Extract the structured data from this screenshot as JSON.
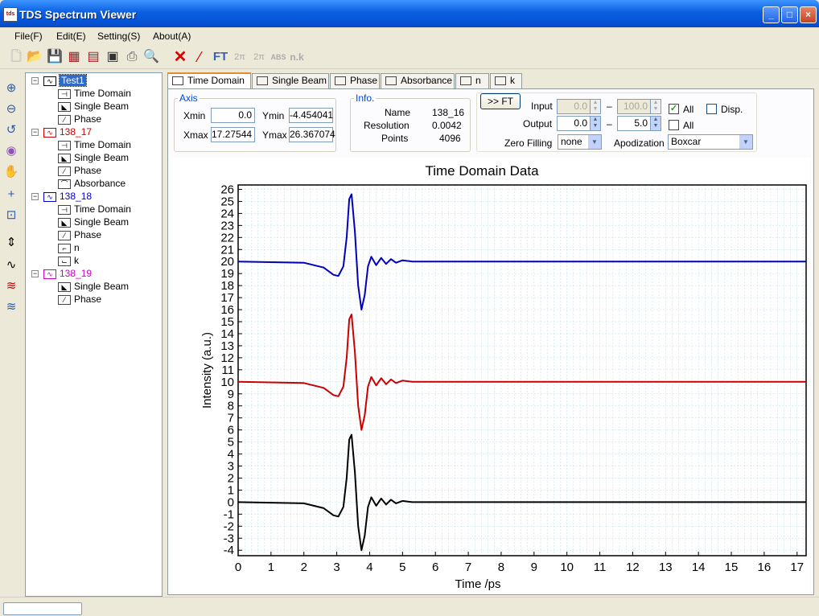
{
  "window": {
    "title": "TDS Spectrum Viewer",
    "icon_text": "tds"
  },
  "menu": [
    "File(F)",
    "Edit(E)",
    "Setting(S)",
    "About(A)"
  ],
  "toolbar": {
    "ft_label": "FT",
    "twopi_1": "2π",
    "twopi_2": "2π",
    "abs_label": "ABS",
    "nk_label": "n.k"
  },
  "tree": [
    {
      "name": "Test1",
      "color": "#000000",
      "children": [
        "Time Domain",
        "Single Beam",
        "Phase"
      ]
    },
    {
      "name": "138_17",
      "color": "#cc0000",
      "children": [
        "Time Domain",
        "Single Beam",
        "Phase",
        "Absorbance"
      ]
    },
    {
      "name": "138_18",
      "color": "#0000cc",
      "children": [
        "Time Domain",
        "Single Beam",
        "Phase",
        "n",
        "k"
      ]
    },
    {
      "name": "138_19",
      "color": "#cc00cc",
      "children": [
        "Single Beam",
        "Phase"
      ]
    }
  ],
  "tabs": [
    "Time Domain",
    "Single Beam",
    "Phase",
    "Absorbance",
    "n",
    "k"
  ],
  "axis": {
    "legend": "Axis",
    "xmin_label": "Xmin",
    "xmin": "0.0",
    "ymin_label": "Ymin",
    "ymin": "-4.454041",
    "xmax_label": "Xmax",
    "xmax": "17.27544",
    "ymax_label": "Ymax",
    "ymax": "26.367074"
  },
  "info": {
    "legend": "Info.",
    "name_label": "Name",
    "name": "138_16",
    "resolution_label": "Resolution",
    "resolution": "0.0042",
    "points_label": "Points",
    "points": "4096"
  },
  "ft": {
    "button": ">> FT",
    "input_label": "Input",
    "input_from": "0.0",
    "input_to": "100.0",
    "dash": "–",
    "output_label": "Output",
    "output_from": "0.0",
    "output_to": "5.0",
    "all_label": "All",
    "disp_label": "Disp.",
    "zero_filling_label": "Zero Filling",
    "zero_filling": "none",
    "apodization_label": "Apodization",
    "apodization": "Boxcar"
  },
  "chart_data": {
    "type": "line",
    "title": "Time Domain Data",
    "xlabel": "Time /ps",
    "ylabel": "Intensity (a.u.)",
    "xlim": [
      0,
      17.275
    ],
    "ylim": [
      -4.454,
      26.367
    ],
    "xticks": [
      0,
      1,
      2,
      3,
      4,
      5,
      6,
      7,
      8,
      9,
      10,
      11,
      12,
      13,
      14,
      15,
      16,
      17
    ],
    "yticks": [
      -4,
      -3,
      -2,
      -1,
      0,
      1,
      2,
      3,
      4,
      5,
      6,
      7,
      8,
      9,
      10,
      11,
      12,
      13,
      14,
      15,
      16,
      17,
      18,
      19,
      20,
      21,
      22,
      23,
      24,
      25,
      26
    ],
    "grid": true,
    "series": [
      {
        "color": "#0000bb",
        "x": [
          0,
          2.0,
          2.6,
          2.9,
          3.05,
          3.2,
          3.3,
          3.38,
          3.45,
          3.55,
          3.65,
          3.75,
          3.85,
          3.95,
          4.05,
          4.2,
          4.35,
          4.5,
          4.65,
          4.8,
          5.0,
          5.3,
          5.8,
          17.27
        ],
        "y": [
          20,
          19.9,
          19.5,
          18.9,
          18.8,
          19.6,
          22.0,
          25.2,
          25.6,
          22.5,
          18.0,
          16.0,
          17.2,
          19.6,
          20.4,
          19.7,
          20.3,
          19.8,
          20.2,
          19.9,
          20.1,
          20.0,
          20.0,
          20.0
        ]
      },
      {
        "color": "#cc0000",
        "x": [
          0,
          2.0,
          2.6,
          2.9,
          3.05,
          3.2,
          3.3,
          3.38,
          3.45,
          3.55,
          3.65,
          3.75,
          3.85,
          3.95,
          4.05,
          4.2,
          4.35,
          4.5,
          4.65,
          4.8,
          5.0,
          5.3,
          5.8,
          17.27
        ],
        "y": [
          10,
          9.9,
          9.5,
          8.9,
          8.8,
          9.6,
          12.0,
          15.2,
          15.6,
          12.5,
          8.0,
          6.0,
          7.2,
          9.6,
          10.4,
          9.7,
          10.3,
          9.8,
          10.2,
          9.9,
          10.1,
          10.0,
          10.0,
          10.0
        ]
      },
      {
        "color": "#000000",
        "x": [
          0,
          2.0,
          2.6,
          2.9,
          3.05,
          3.2,
          3.3,
          3.38,
          3.45,
          3.55,
          3.65,
          3.75,
          3.85,
          3.95,
          4.05,
          4.2,
          4.35,
          4.5,
          4.65,
          4.8,
          5.0,
          5.3,
          5.8,
          17.27
        ],
        "y": [
          0,
          -0.1,
          -0.5,
          -1.1,
          -1.2,
          -0.4,
          2.0,
          5.2,
          5.6,
          2.5,
          -2.0,
          -4.0,
          -2.8,
          -0.4,
          0.4,
          -0.3,
          0.3,
          -0.2,
          0.2,
          -0.1,
          0.1,
          0.0,
          0.0,
          0.0
        ]
      }
    ]
  }
}
